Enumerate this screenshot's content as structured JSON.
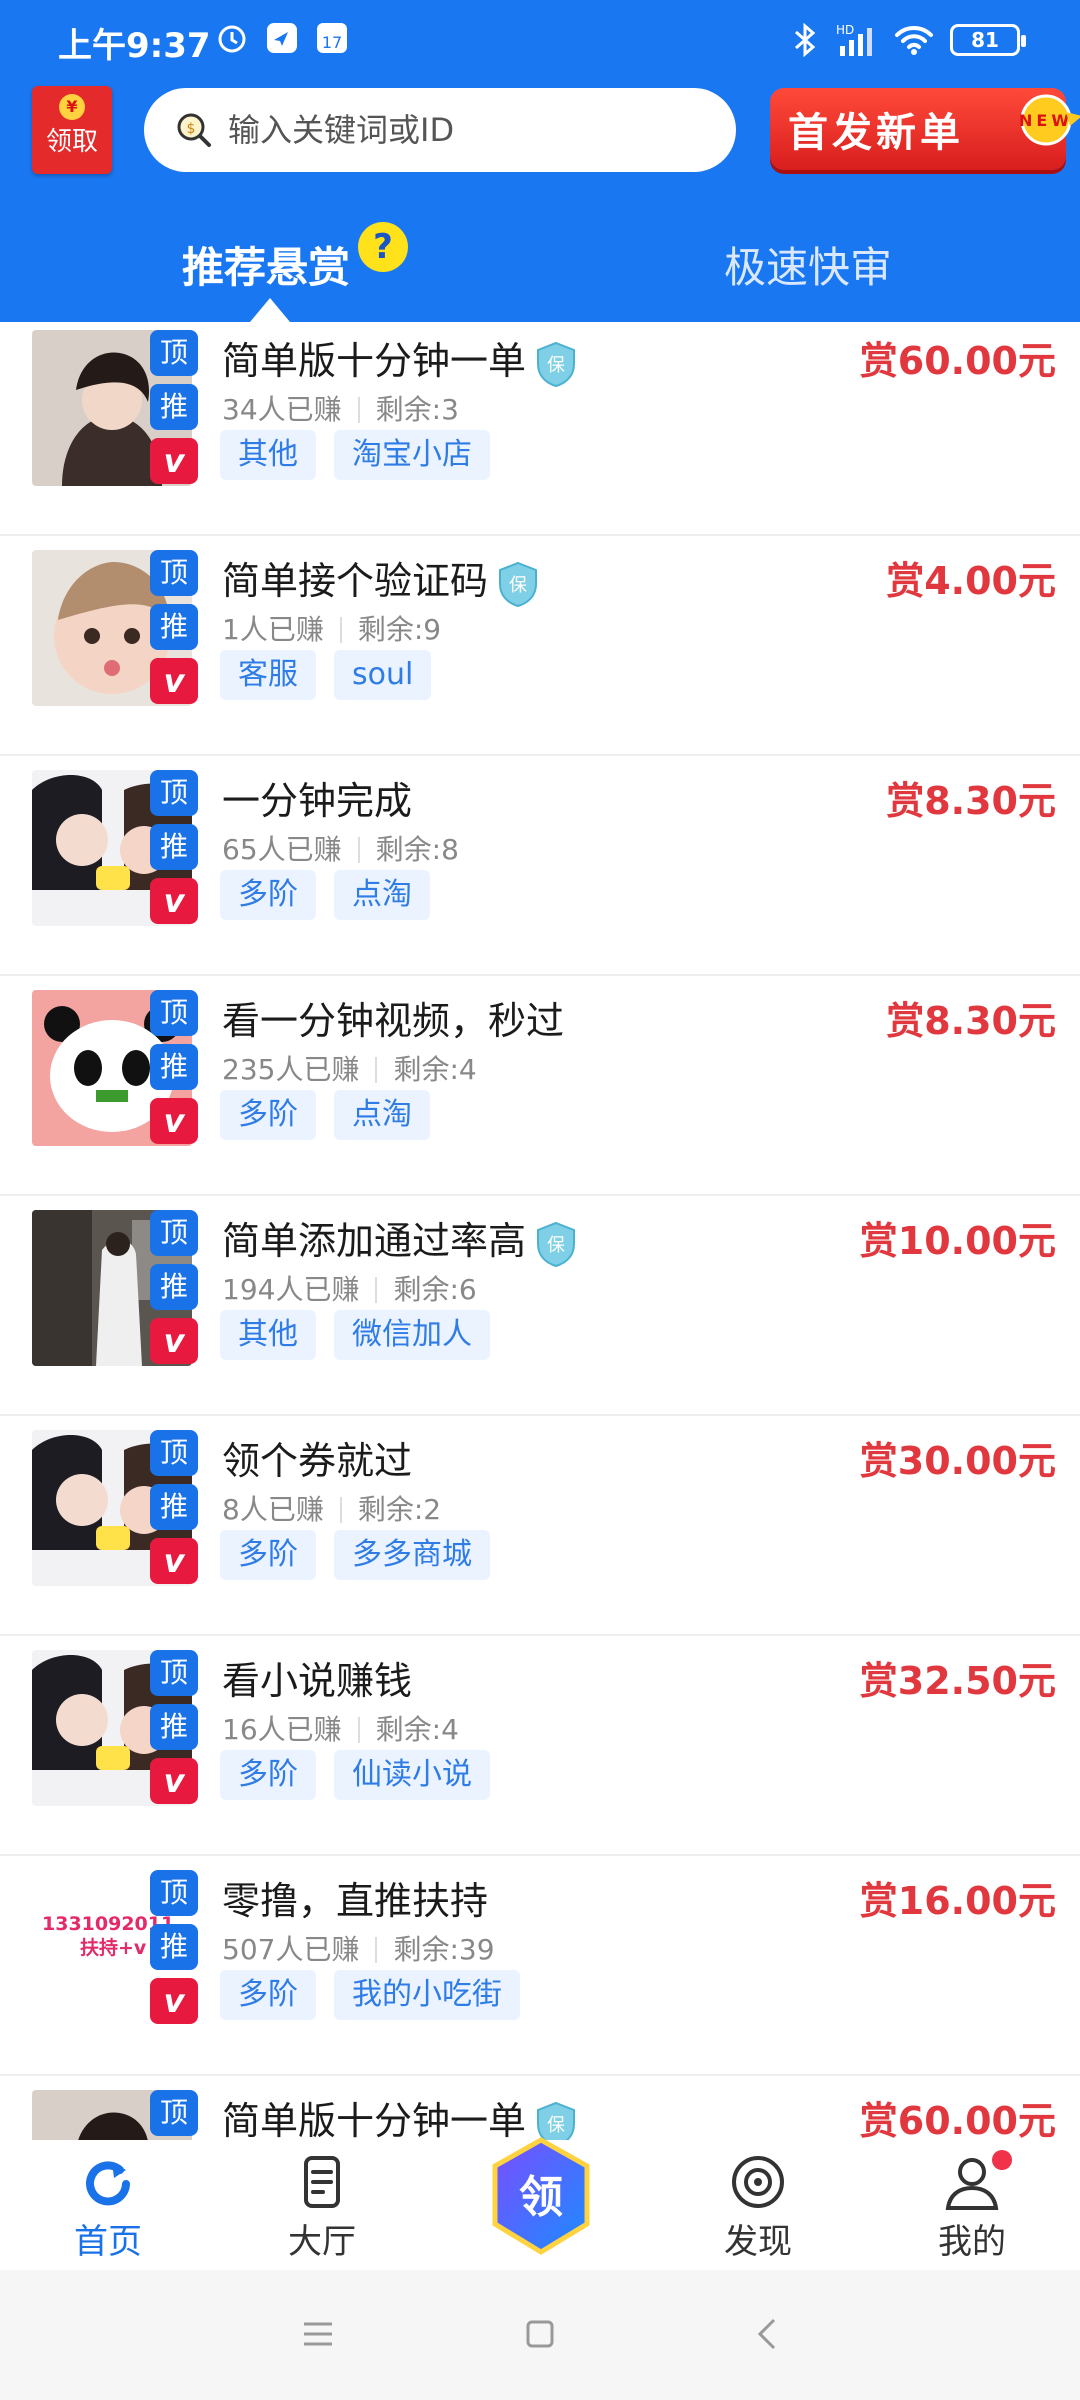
{
  "status": {
    "time": "上午9:37",
    "battery": "81",
    "network": "HD"
  },
  "header": {
    "redpacket_label": "领取",
    "search_placeholder": "输入关键词或ID",
    "first_button": "首发新单",
    "new_badge": "NEW"
  },
  "tabs": [
    {
      "label": "推荐悬赏",
      "active": true,
      "help": "?"
    },
    {
      "label": "极速快审",
      "active": false
    }
  ],
  "badges": {
    "top": "顶",
    "recommend": "推",
    "v": "v",
    "guarantee": "保"
  },
  "items": [
    {
      "title": "简单版十分钟一单",
      "earned": "34人已赚",
      "remaining": "剩余:3",
      "tags": [
        "其他",
        "淘宝小店"
      ],
      "price": "赏60.00元",
      "guarantee": true,
      "thumb": "girl-photo"
    },
    {
      "title": "简单接个验证码",
      "earned": "1人已赚",
      "remaining": "剩余:9",
      "tags": [
        "客服",
        "soul"
      ],
      "price": "赏4.00元",
      "guarantee": true,
      "thumb": "child-photo"
    },
    {
      "title": "一分钟完成",
      "earned": "65人已赚",
      "remaining": "剩余:8",
      "tags": [
        "多阶",
        "点淘"
      ],
      "price": "赏8.30元",
      "guarantee": false,
      "thumb": "couple-photo"
    },
    {
      "title": "看一分钟视频，秒过",
      "earned": "235人已赚",
      "remaining": "剩余:4",
      "tags": [
        "多阶",
        "点淘"
      ],
      "price": "赏8.30元",
      "guarantee": false,
      "thumb": "panda"
    },
    {
      "title": "简单添加通过率高",
      "earned": "194人已赚",
      "remaining": "剩余:6",
      "tags": [
        "其他",
        "微信加人"
      ],
      "price": "赏10.00元",
      "guarantee": true,
      "thumb": "street-photo"
    },
    {
      "title": "领个券就过",
      "earned": "8人已赚",
      "remaining": "剩余:2",
      "tags": [
        "多阶",
        "多多商城"
      ],
      "price": "赏30.00元",
      "guarantee": false,
      "thumb": "couple-photo"
    },
    {
      "title": "看小说赚钱",
      "earned": "16人已赚",
      "remaining": "剩余:4",
      "tags": [
        "多阶",
        "仙读小说"
      ],
      "price": "赏32.50元",
      "guarantee": false,
      "thumb": "couple-photo"
    },
    {
      "title": "零撸，直推扶持",
      "earned": "507人已赚",
      "remaining": "剩余:39",
      "tags": [
        "多阶",
        "我的小吃街"
      ],
      "price": "赏16.00元",
      "guarantee": false,
      "thumb": "text-image",
      "thumb_text": [
        "1331092011",
        "扶持+v"
      ]
    },
    {
      "title": "简单版十分钟一单",
      "earned": "",
      "remaining": "",
      "tags": [],
      "price": "赏60.00元",
      "guarantee": true,
      "thumb": "girl-photo"
    }
  ],
  "tabbar": [
    {
      "label": "首页",
      "icon": "refresh-icon",
      "active": true
    },
    {
      "label": "大厅",
      "icon": "document-icon"
    },
    {
      "label": "领",
      "icon": "hexagon-claim-icon"
    },
    {
      "label": "发现",
      "icon": "target-icon"
    },
    {
      "label": "我的",
      "icon": "user-icon",
      "dot": true
    }
  ],
  "colors": {
    "primary": "#1a77f2",
    "price": "#e0383e",
    "tag_bg": "#eaf3ff",
    "tag_text": "#2f7ce6",
    "v_badge": "#e8193f"
  }
}
